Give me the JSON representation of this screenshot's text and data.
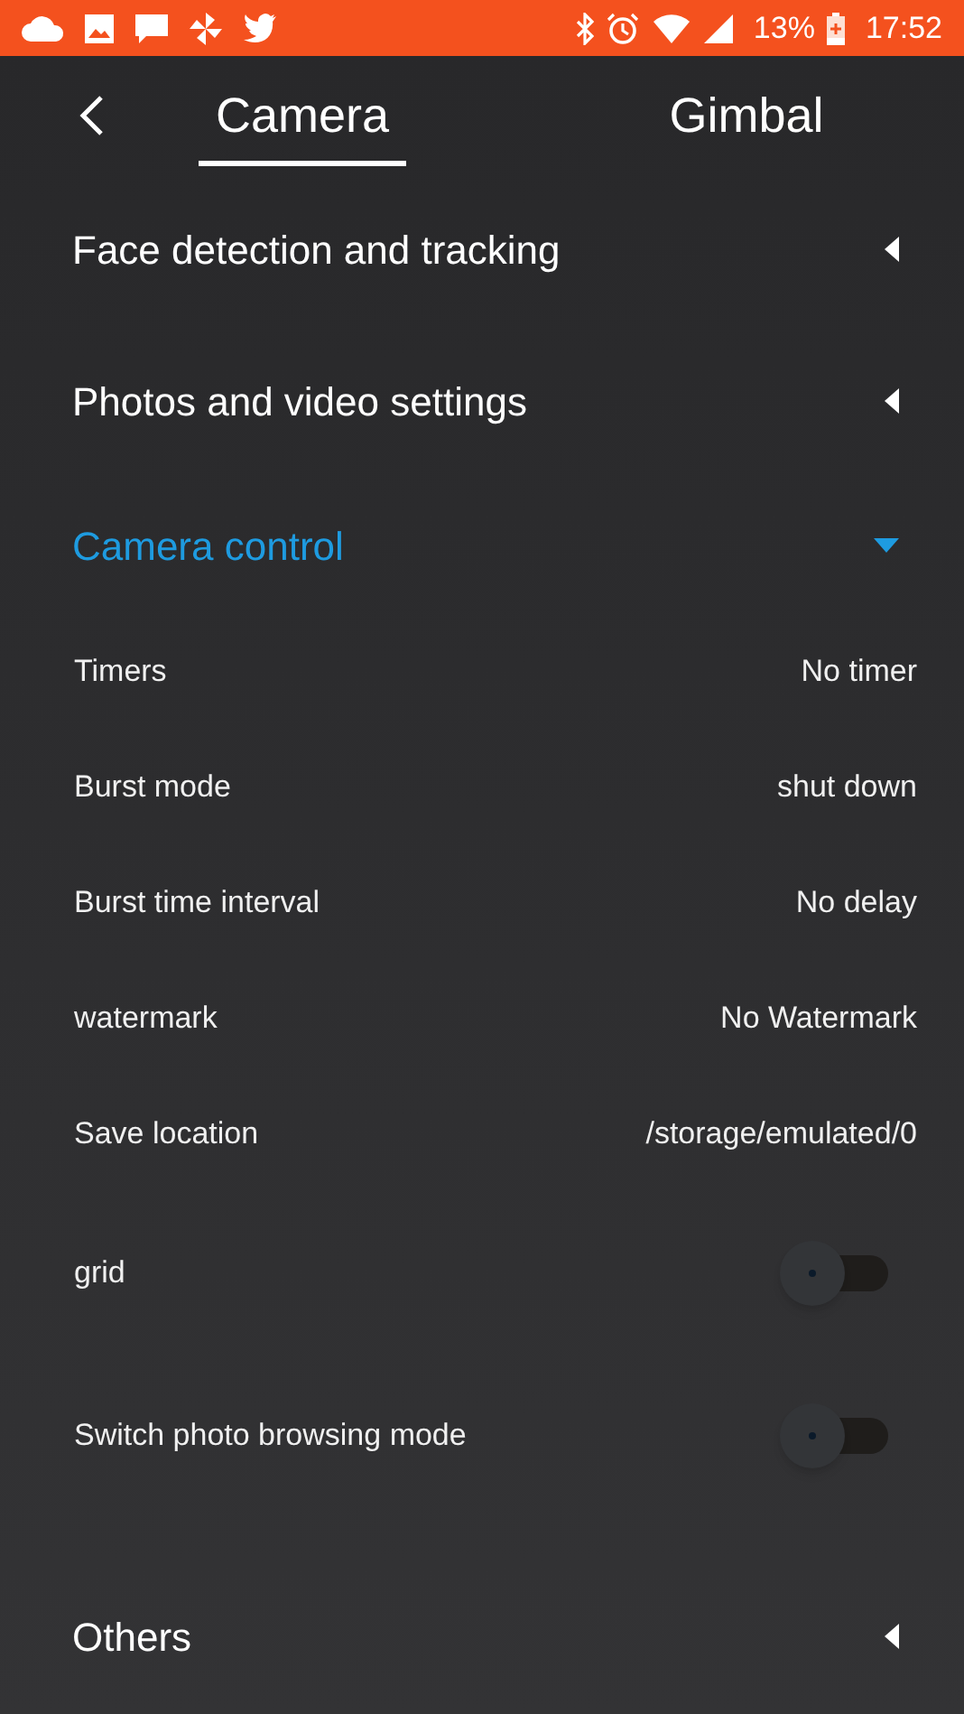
{
  "status_bar": {
    "battery": "13%",
    "time": "17:52"
  },
  "tabs": [
    {
      "label": "Camera",
      "selected": true
    },
    {
      "label": "Gimbal",
      "selected": false
    }
  ],
  "sections": [
    {
      "title": "Face detection and tracking",
      "expanded": false
    },
    {
      "title": "Photos and video settings",
      "expanded": false
    },
    {
      "title": "Camera control",
      "expanded": true,
      "items": [
        {
          "kind": "value",
          "label": "Timers",
          "value": "No timer"
        },
        {
          "kind": "value",
          "label": "Burst mode",
          "value": "shut down"
        },
        {
          "kind": "value",
          "label": "Burst time interval",
          "value": "No delay"
        },
        {
          "kind": "value",
          "label": "watermark",
          "value": "No Watermark"
        },
        {
          "kind": "value",
          "label": "Save location",
          "value": "/storage/emulated/0"
        },
        {
          "kind": "toggle",
          "label": "grid",
          "on": false
        },
        {
          "kind": "toggle",
          "label": "Switch photo browsing mode",
          "on": false
        }
      ]
    },
    {
      "title": "Others",
      "expanded": false
    }
  ]
}
